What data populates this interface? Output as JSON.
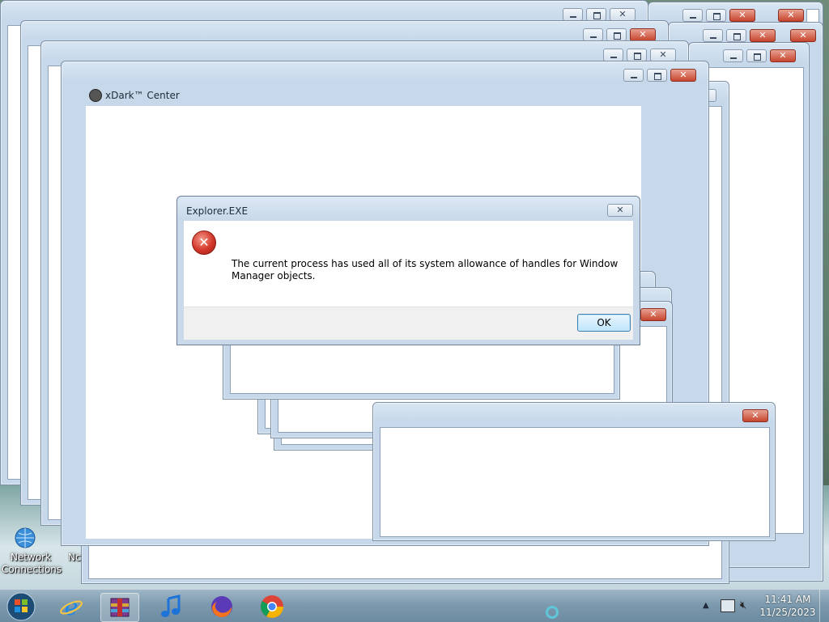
{
  "app_window": {
    "title": "xDark™ Center"
  },
  "dialog": {
    "title": "Explorer.EXE",
    "message": "The current process has used all of its system allowance of handles for Window Manager objects.",
    "ok_label": "OK"
  },
  "desktop": {
    "icons": [
      {
        "label": "Network Connections",
        "icon": "network-globe-icon"
      },
      {
        "label": "Nc",
        "icon": "partial-icon"
      }
    ]
  },
  "taskbar": {
    "pinned": [
      {
        "name": "Start",
        "icon": "windows-orb-icon"
      },
      {
        "name": "Internet Explorer",
        "icon": "ie-icon"
      },
      {
        "name": "WinRAR",
        "icon": "archive-icon"
      },
      {
        "name": "iTunes",
        "icon": "music-note-icon"
      },
      {
        "name": "Firefox",
        "icon": "firefox-icon"
      },
      {
        "name": "Chrome",
        "icon": "chrome-icon"
      }
    ],
    "clock": {
      "time": "11:41 AM",
      "date": "11/25/2023"
    }
  },
  "colors": {
    "close_red": "#c7452e",
    "frame": "#c6d8ea",
    "taskbar": "#7d9aae"
  }
}
